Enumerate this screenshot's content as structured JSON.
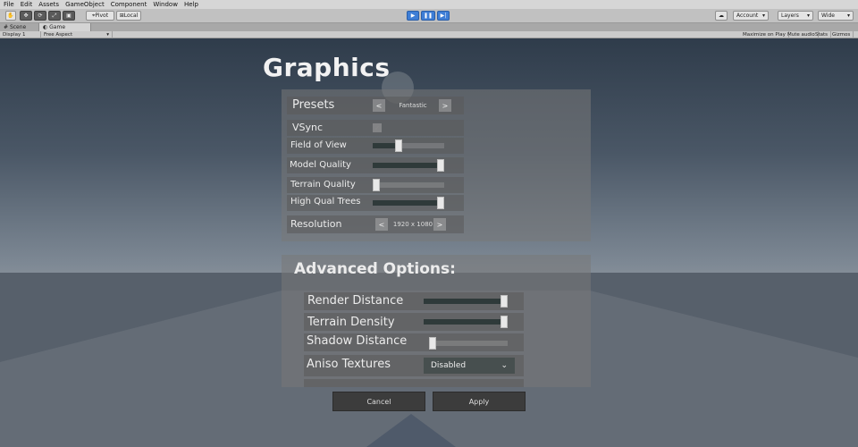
{
  "menu": [
    "File",
    "Edit",
    "Assets",
    "GameObject",
    "Component",
    "Window",
    "Help"
  ],
  "toolbar": {
    "pivot_label": "Pivot",
    "local_label": "Local",
    "account_label": "Account",
    "layers_label": "Layers",
    "layout_label": "Wide"
  },
  "tabs": {
    "scene": "Scene",
    "game": "Game"
  },
  "gamebar": {
    "display": "Display 1",
    "aspect": "Free Aspect",
    "maximize": "Maximize on Play",
    "mute": "Mute audio",
    "stats": "Stats",
    "gizmos": "Gizmos"
  },
  "menu_ui": {
    "title": "Graphics",
    "presets": {
      "label": "Presets",
      "value": "Fantastic",
      "prev": "<",
      "next": ">"
    },
    "vsync": {
      "label": "VSync",
      "checked": true
    },
    "fov": {
      "label": "Field of View",
      "value": 0.35
    },
    "model_quality": {
      "label": "Model Quality",
      "value": 1.0
    },
    "terrain_quality": {
      "label": "Terrain Quality",
      "value": 0.0
    },
    "high_qual_trees": {
      "label": "High Qual Trees",
      "value": 1.0
    },
    "resolution": {
      "label": "Resolution",
      "value": "1920 x 1080",
      "prev": "<",
      "next": ">"
    },
    "advanced": {
      "title": "Advanced Options:",
      "render_distance": {
        "label": "Render Distance",
        "value": 1.0
      },
      "terrain_density": {
        "label": "Terrain Density",
        "value": 1.0
      },
      "shadow_distance": {
        "label": "Shadow Distance",
        "value": 0.0
      },
      "aniso": {
        "label": "Aniso Textures",
        "value": "Disabled"
      }
    },
    "cancel": "Cancel",
    "apply": "Apply"
  }
}
